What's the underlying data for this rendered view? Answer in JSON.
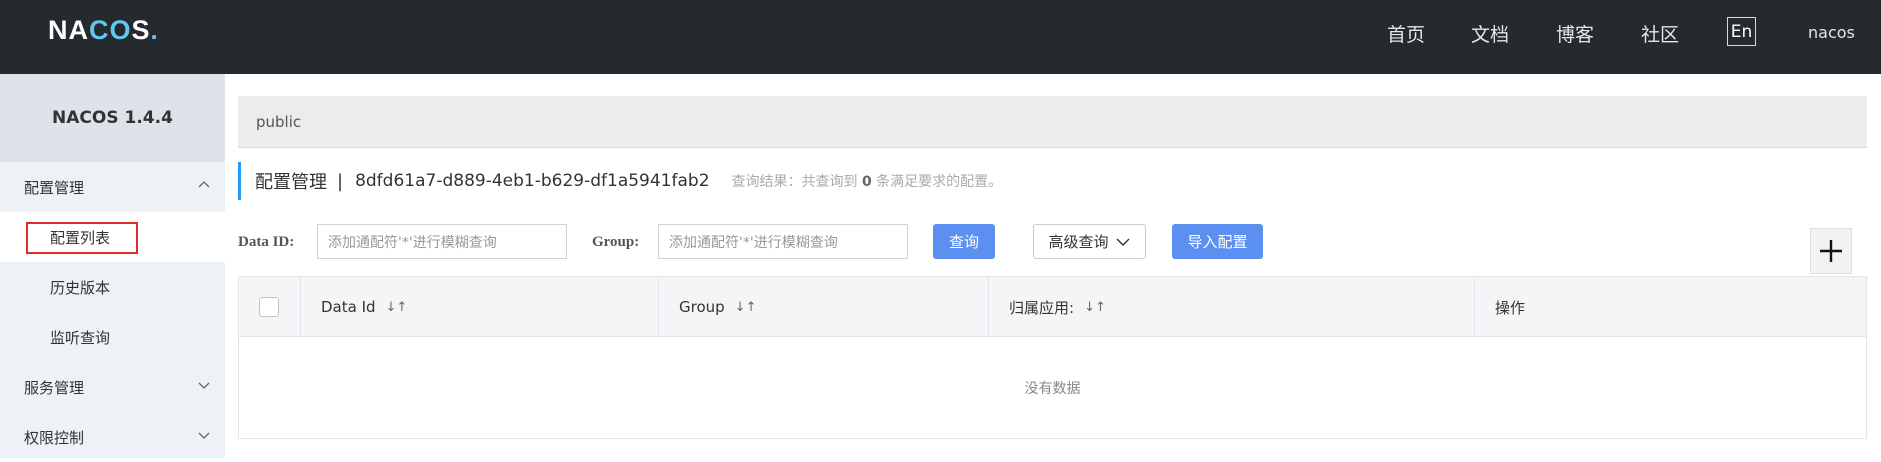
{
  "header": {
    "logo_left": "NA",
    "logo_mid": "CO",
    "logo_right": "S",
    "logo_dot": ".",
    "nav": [
      "首页",
      "文档",
      "博客",
      "社区"
    ],
    "lang_label": "En",
    "user": "nacos"
  },
  "sidebar": {
    "title": "NACOS 1.4.4",
    "groups": [
      {
        "label": "配置管理",
        "expanded": true,
        "items": [
          "配置列表",
          "历史版本",
          "监听查询"
        ]
      },
      {
        "label": "服务管理",
        "expanded": false
      },
      {
        "label": "权限控制",
        "expanded": false
      }
    ],
    "active_item": "配置列表"
  },
  "main": {
    "namespace": "public",
    "breadcrumb": {
      "title": "配置管理",
      "separator": "|",
      "namespace_id": "8dfd61a7-d889-4eb1-b629-df1a5941fab2",
      "result_prefix": "查询结果：共查询到",
      "result_count": "0",
      "result_suffix": "条满足要求的配置。"
    },
    "filters": {
      "data_id_label": "Data ID:",
      "data_id_placeholder": "添加通配符'*'进行模糊查询",
      "group_label": "Group:",
      "group_placeholder": "添加通配符'*'进行模糊查询",
      "query_button": "查询",
      "advanced_button": "高级查询",
      "import_button": "导入配置"
    },
    "table": {
      "columns": [
        "Data Id",
        "Group",
        "归属应用:",
        "操作"
      ],
      "empty_text": "没有数据"
    }
  },
  "colors": {
    "topbar": "#252a2f",
    "accent": "#5b8ff0",
    "highlight_box": "#e02b2b"
  }
}
